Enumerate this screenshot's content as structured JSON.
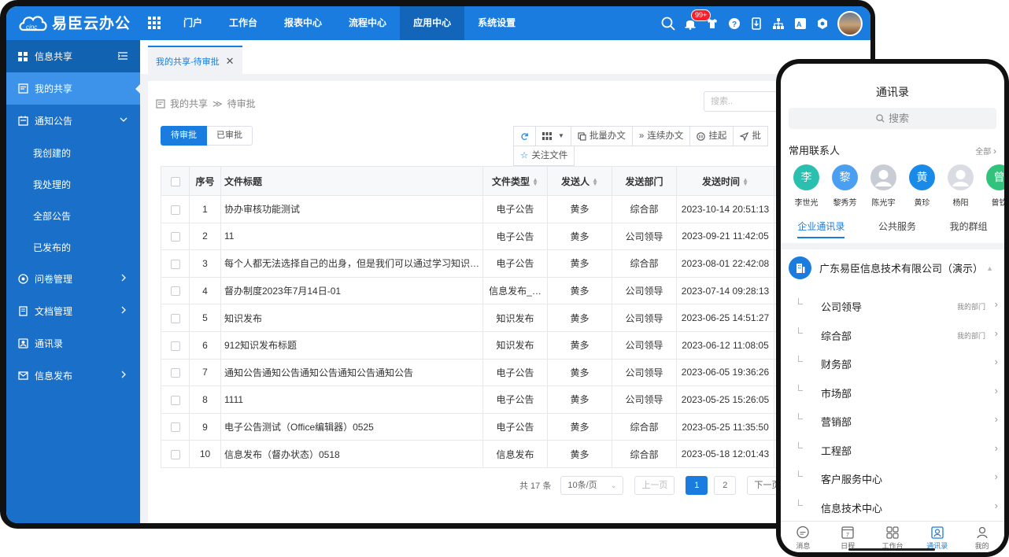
{
  "app": {
    "brand": "易臣云办公",
    "logo_mark": "cinc"
  },
  "topnav": [
    {
      "label": "门户"
    },
    {
      "label": "工作台"
    },
    {
      "label": "报表中心"
    },
    {
      "label": "流程中心"
    },
    {
      "label": "应用中心"
    },
    {
      "label": "系统设置"
    }
  ],
  "topnav_active_index": 4,
  "top_icons": {
    "notification_badge": "99+"
  },
  "sidebar": {
    "header": "信息共享",
    "items": [
      {
        "label": "我的共享",
        "type": "item",
        "active": true
      },
      {
        "label": "通知公告",
        "type": "group",
        "expanded": true
      },
      {
        "label": "我创建的",
        "type": "sub"
      },
      {
        "label": "我处理的",
        "type": "sub"
      },
      {
        "label": "全部公告",
        "type": "sub"
      },
      {
        "label": "已发布的",
        "type": "sub"
      },
      {
        "label": "问卷管理",
        "type": "group"
      },
      {
        "label": "文档管理",
        "type": "group"
      },
      {
        "label": "通讯录",
        "type": "item"
      },
      {
        "label": "信息发布",
        "type": "group"
      }
    ]
  },
  "tab": {
    "label": "我的共享-待审批",
    "close": "✕"
  },
  "breadcrumb": {
    "root": "我的共享",
    "sep": "≫",
    "current": "待审批"
  },
  "search": {
    "placeholder": "搜索.."
  },
  "segment": {
    "pending": "待审批",
    "approved": "已审批"
  },
  "toolbar": {
    "batch": "批量办文",
    "continuous": "连续办文",
    "hold": "挂起",
    "forward_partial": "批",
    "follow": "关注文件"
  },
  "table": {
    "headers": {
      "no": "序号",
      "title": "文件标题",
      "type": "文件类型",
      "sender": "发送人",
      "dept": "发送部门",
      "time": "发送时间"
    },
    "rows": [
      {
        "no": "1",
        "title": "协办审核功能测试",
        "type": "电子公告",
        "sender": "黄多",
        "dept": "综合部",
        "time": "2023-10-14 20:51:13"
      },
      {
        "no": "2",
        "title": "11",
        "type": "电子公告",
        "sender": "黄多",
        "dept": "公司领导",
        "time": "2023-09-21 11:42:05"
      },
      {
        "no": "3",
        "title": "每个人都无法选择自己的出身，但是我们可以通过学习知识…",
        "type": "电子公告",
        "sender": "黄多",
        "dept": "综合部",
        "time": "2023-08-01 22:42:08"
      },
      {
        "no": "4",
        "title": "督办制度2023年7月14日-01",
        "type": "信息发布_…",
        "sender": "黄多",
        "dept": "公司领导",
        "time": "2023-07-14 09:28:13"
      },
      {
        "no": "5",
        "title": "知识发布",
        "type": "知识发布",
        "sender": "黄多",
        "dept": "公司领导",
        "time": "2023-06-25 14:51:27"
      },
      {
        "no": "6",
        "title": "912知识发布标题",
        "type": "知识发布",
        "sender": "黄多",
        "dept": "公司领导",
        "time": "2023-06-12 11:08:05"
      },
      {
        "no": "7",
        "title": "通知公告通知公告通知公告通知公告通知公告",
        "type": "电子公告",
        "sender": "黄多",
        "dept": "公司领导",
        "time": "2023-06-05 19:36:26"
      },
      {
        "no": "8",
        "title": "1111",
        "type": "电子公告",
        "sender": "黄多",
        "dept": "公司领导",
        "time": "2023-05-25 15:26:05"
      },
      {
        "no": "9",
        "title": "电子公告测试（Office编辑器）0525",
        "type": "电子公告",
        "sender": "黄多",
        "dept": "综合部",
        "time": "2023-05-25 11:35:50"
      },
      {
        "no": "10",
        "title": "信息发布（督办状态）0518",
        "type": "信息发布",
        "sender": "黄多",
        "dept": "综合部",
        "time": "2023-05-18 12:01:43"
      }
    ]
  },
  "pager": {
    "total": "共 17 条",
    "page_size": "10条/页",
    "prev": "上一页",
    "pages": [
      "1",
      "2"
    ],
    "current": "1",
    "next": "下一页"
  },
  "phone": {
    "title": "通讯录",
    "search": "搜索",
    "frequent_title": "常用联系人",
    "all": "全部",
    "contacts": [
      {
        "initial": "李",
        "name": "李世光",
        "color": "#2bbfb0"
      },
      {
        "initial": "黎",
        "name": "黎秀芳",
        "color": "#4a9ff0"
      },
      {
        "initial": "",
        "name": "陈光宇",
        "color": "#c8ccd4"
      },
      {
        "initial": "黄",
        "name": "黄珍",
        "color": "#1a8ae8"
      },
      {
        "initial": "",
        "name": "杨阳",
        "color": "#d9dde3"
      },
      {
        "initial": "曾",
        "name": "曾钦",
        "color": "#31c27c"
      }
    ],
    "tabs": [
      "企业通讯录",
      "公共服务",
      "我的群组"
    ],
    "org": "广东易臣信息技术有限公司（演示）",
    "depts": [
      {
        "name": "公司领导",
        "mine": "我的部门"
      },
      {
        "name": "综合部",
        "mine": "我的部门"
      },
      {
        "name": "财务部",
        "mine": ""
      },
      {
        "name": "市场部",
        "mine": ""
      },
      {
        "name": "营销部",
        "mine": ""
      },
      {
        "name": "工程部",
        "mine": ""
      },
      {
        "name": "客户服务中心",
        "mine": ""
      },
      {
        "name": "信息技术中心",
        "mine": ""
      }
    ],
    "bottom": [
      {
        "label": "消息"
      },
      {
        "label": "日程",
        "calendar_day": "7"
      },
      {
        "label": "工作台"
      },
      {
        "label": "通讯录"
      },
      {
        "label": "我的"
      }
    ]
  }
}
